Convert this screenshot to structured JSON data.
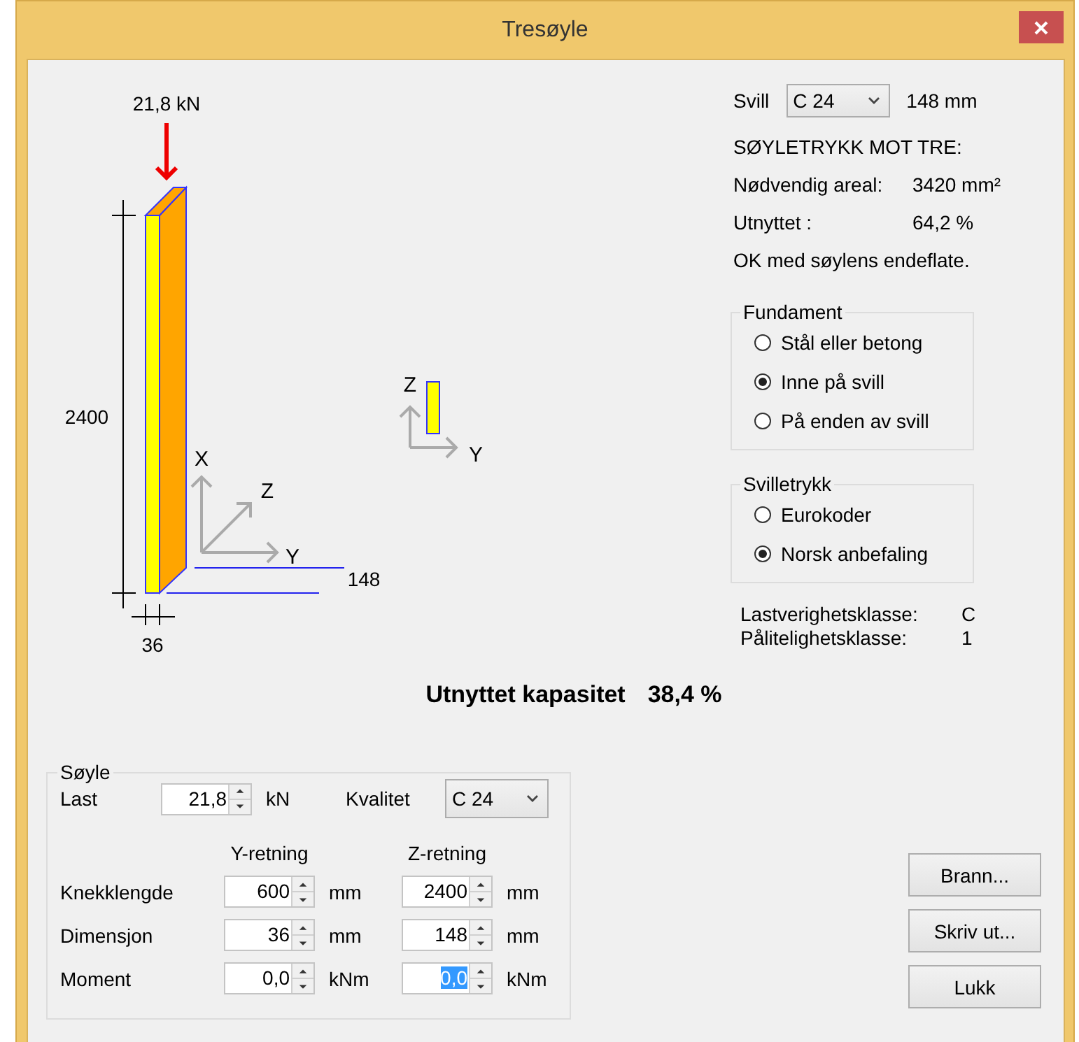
{
  "window": {
    "title": "Tresøyle"
  },
  "drawing": {
    "load_label": "21,8 kN",
    "height_label": "2400",
    "thickness_label": "36",
    "width_label": "148",
    "axes": [
      "X",
      "Z",
      "Y"
    ],
    "section_axes": [
      "Z",
      "Y"
    ]
  },
  "sill": {
    "label": "Svill",
    "grade": "C 24",
    "size": "148 mm"
  },
  "pressure": {
    "heading": "SØYLETRYKK MOT TRE:",
    "rows": [
      {
        "label": "Nødvendig areal:",
        "value": "3420 mm²"
      },
      {
        "label": "Utnyttet :",
        "value": "64,2 %"
      }
    ],
    "message": "OK med søylens endeflate."
  },
  "groups": [
    {
      "title": "Fundament",
      "options": [
        {
          "label": "Stål eller betong",
          "selected": false
        },
        {
          "label": "Inne på svill",
          "selected": true
        },
        {
          "label": "På enden av svill",
          "selected": false
        }
      ]
    },
    {
      "title": "Svilletrykk",
      "options": [
        {
          "label": "Eurokoder",
          "selected": false
        },
        {
          "label": "Norsk anbefaling",
          "selected": true
        }
      ]
    }
  ],
  "classes": [
    {
      "label": "Lastverighetsklasse:",
      "value": "C"
    },
    {
      "label": "Pålitelighetsklasse:",
      "value": "1"
    }
  ],
  "result": {
    "label": "Utnyttet kapasitet",
    "value": "38,4 %"
  },
  "column": {
    "title": "Søyle",
    "load": {
      "label": "Last",
      "value": "21,8",
      "unit": "kN"
    },
    "quality": {
      "label": "Kvalitet",
      "value": "C 24"
    },
    "headers": [
      "Y-retning",
      "Z-retning"
    ],
    "rows": [
      {
        "label": "Knekklengde",
        "fields": [
          {
            "value": "600",
            "unit": "mm",
            "focused": false
          },
          {
            "value": "2400",
            "unit": "mm",
            "focused": false
          }
        ]
      },
      {
        "label": "Dimensjon",
        "fields": [
          {
            "value": "36",
            "unit": "mm",
            "focused": false
          },
          {
            "value": "148",
            "unit": "mm",
            "focused": false
          }
        ]
      },
      {
        "label": "Moment",
        "fields": [
          {
            "value": "0,0",
            "unit": "kNm",
            "focused": false
          },
          {
            "value": "0,0",
            "unit": "kNm",
            "focused": true
          }
        ]
      }
    ]
  },
  "buttons": [
    "Brann...",
    "Skriv ut...",
    "Lukk"
  ]
}
